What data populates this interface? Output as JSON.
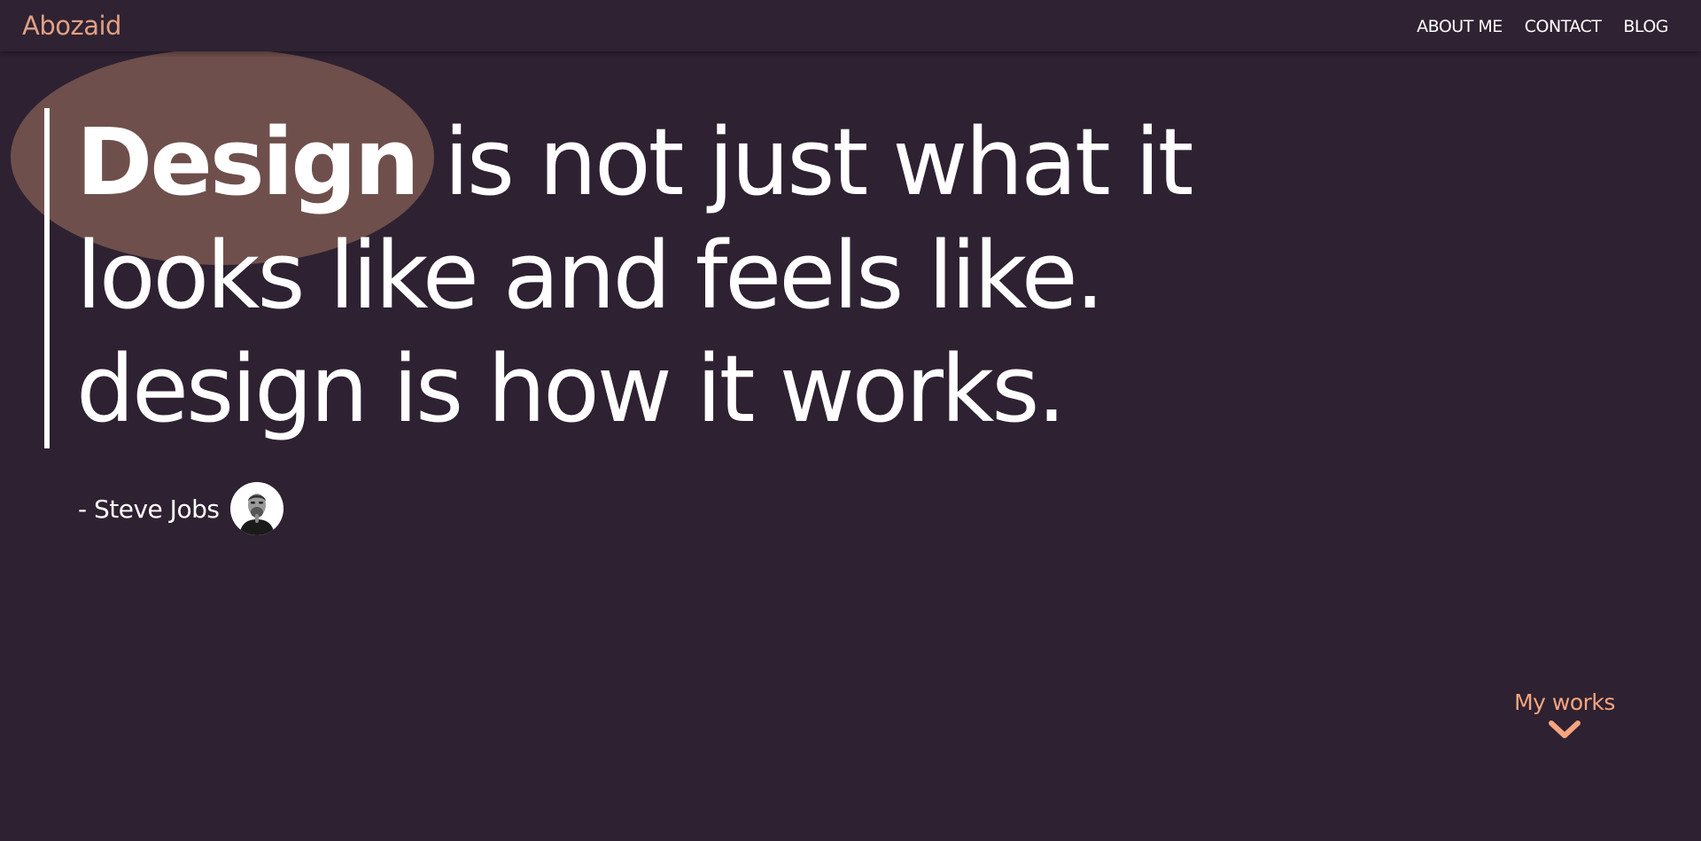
{
  "brand": "Abozaid",
  "nav": {
    "items": [
      {
        "label": "ABOUT ME"
      },
      {
        "label": "CONTACT"
      },
      {
        "label": "BLOG"
      }
    ]
  },
  "quote": {
    "emphasis": "Design",
    "line1_rest": " is not just what it",
    "line2": "looks like and feels like.",
    "line3": "design is how it works."
  },
  "author": {
    "name": "- Steve Jobs",
    "avatar_icon": "steve-jobs-portrait"
  },
  "scroll_hint": {
    "label": "My works",
    "icon": "chevron-down-icon"
  },
  "colors": {
    "background": "#2e2131",
    "accent": "#e0a084",
    "blob": "#6e4f4c",
    "works_accent": "#f6a57f",
    "text": "#ffffff"
  }
}
